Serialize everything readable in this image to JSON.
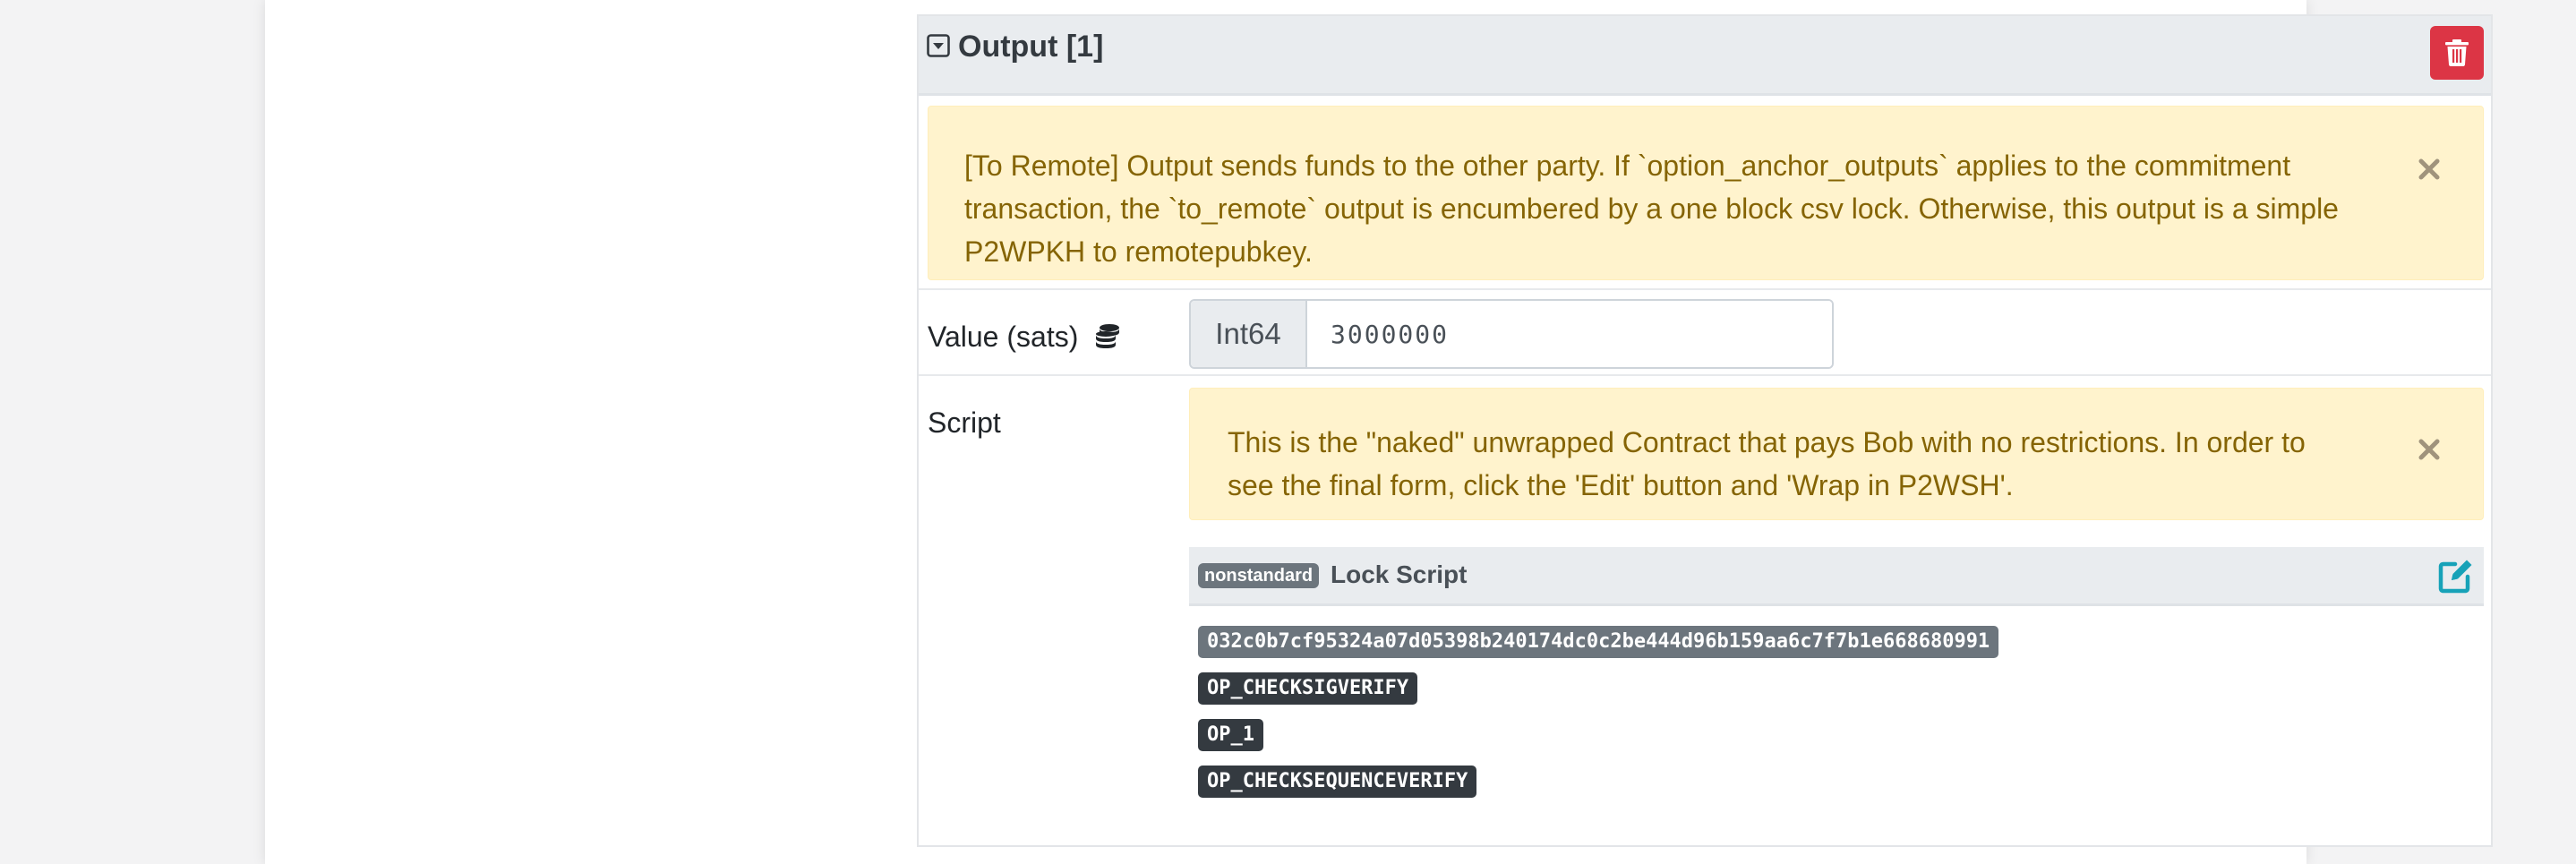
{
  "output": {
    "title": "Output [1]",
    "collapse_icon": "caret-square-down-icon",
    "delete_icon": "trash-icon"
  },
  "alerts": {
    "output_description": "[To Remote] Output sends funds to the other party. If `option_anchor_outputs` applies to the commitment transaction, the `to_remote` output is encumbered by a one block csv lock. Otherwise, this output is a simple P2WPKH to remotepubkey.",
    "script_description": "This is the \"naked\" unwrapped Contract that pays Bob with no restrictions. In order to see the final form, click the 'Edit' button and 'Wrap in P2WSH'.",
    "close_symbol": "×"
  },
  "value_field": {
    "label": "Value (sats)",
    "icon": "coins-icon",
    "type_prefix": "Int64",
    "value": "3000000"
  },
  "script_field": {
    "label": "Script",
    "badge": "nonstandard",
    "title": "Lock Script",
    "edit_icon": "edit-icon",
    "ops": [
      {
        "text": "032c0b7cf95324a07d05398b240174dc0c2be444d96b159aa6c7f7b1e668680991",
        "kind": "data"
      },
      {
        "text": "OP_CHECKSIGVERIFY",
        "kind": "opcode"
      },
      {
        "text": "OP_1",
        "kind": "opcode"
      },
      {
        "text": "OP_CHECKSEQUENCEVERIFY",
        "kind": "opcode"
      }
    ]
  },
  "colors": {
    "danger": "#dc3545",
    "warning_bg": "#fff3cd",
    "warning_text": "#856404",
    "edit_accent": "#17a2b8",
    "badge_secondary": "#6c757d",
    "badge_dark": "#343a40"
  }
}
